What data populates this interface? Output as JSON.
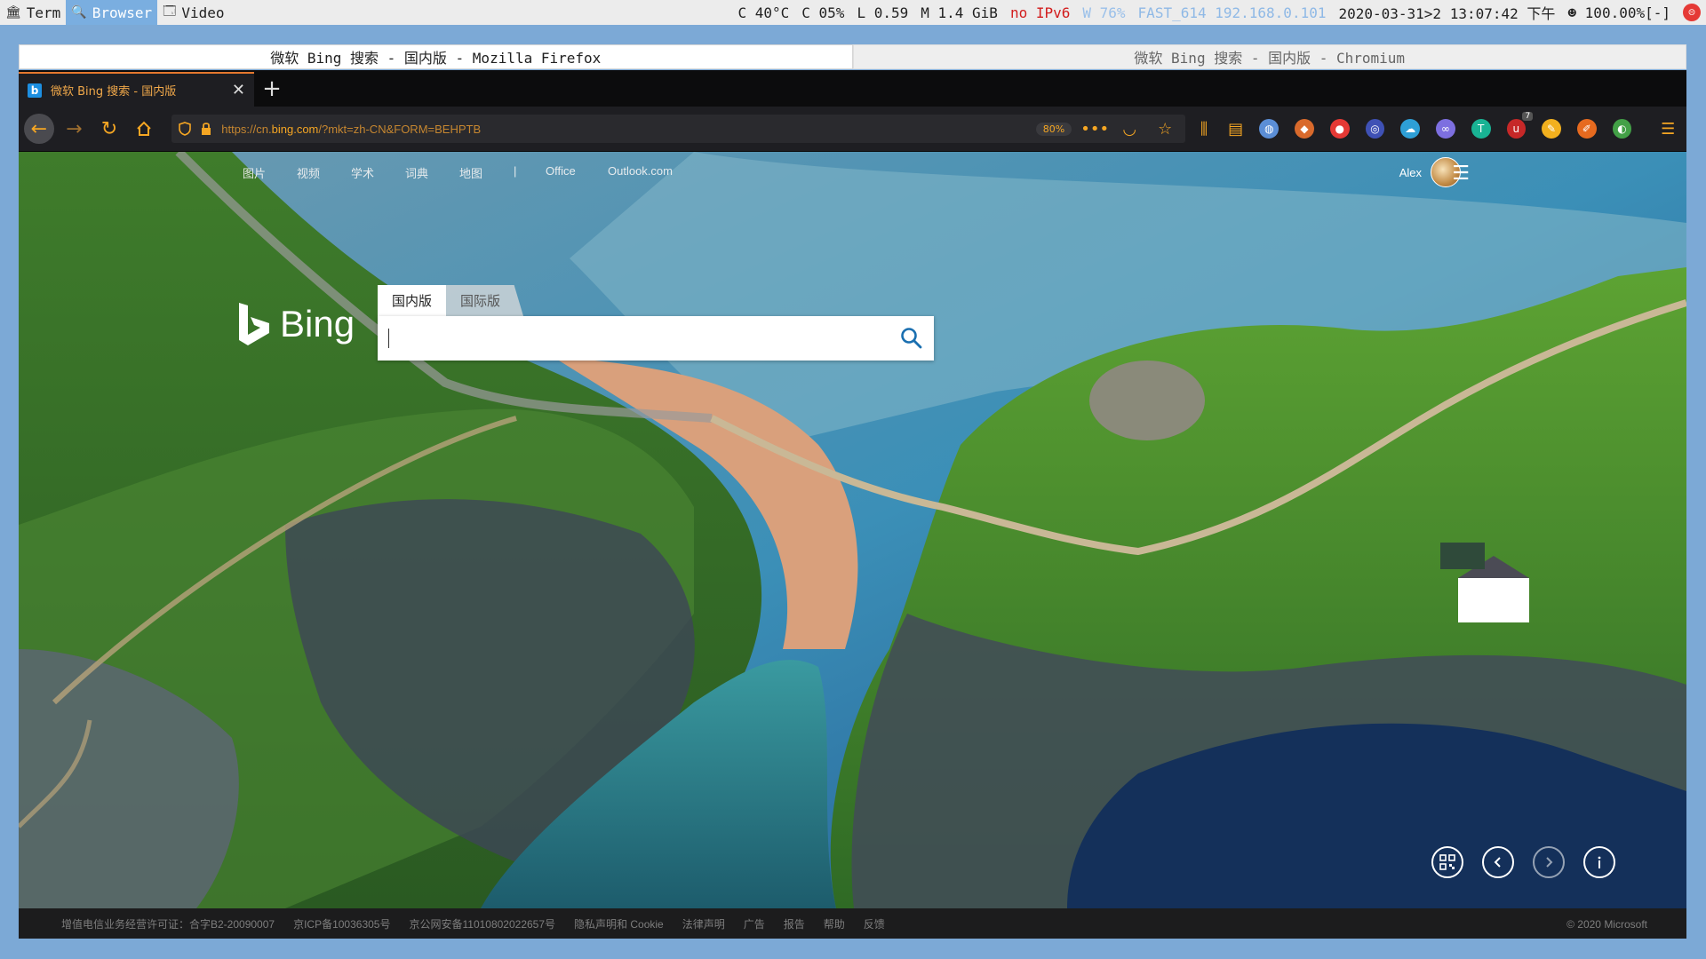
{
  "workspaces": [
    {
      "icon": "🏛",
      "label": "Term",
      "active": false
    },
    {
      "icon": "🔍",
      "label": "Browser",
      "active": true
    },
    {
      "icon": "🗔",
      "label": "Video",
      "active": false
    }
  ],
  "status": {
    "temp": "C 40°C",
    "cpu": "C 05%",
    "load": "L 0.59",
    "mem": "M 1.4 GiB",
    "ipv6": "no IPv6",
    "wifi": "W 76%",
    "net": "FAST_614 192.168.0.101",
    "datetime": "2020-03-31>2 13:07:42 下午",
    "volume": "☻ 100.00%[-]"
  },
  "wm_tabs": {
    "firefox": "微软 Bing 搜索 - 国内版 - Mozilla Firefox",
    "chromium": "微软 Bing 搜索 - 国内版 - Chromium"
  },
  "browser": {
    "tab_title": "微软 Bing 搜索 - 国内版",
    "url_prefix": "https://cn.",
    "url_domain": "bing.com",
    "url_rest": "/?mkt=zh-CN&FORM=BEHPTB",
    "zoom": "80%",
    "ext_badge": "7"
  },
  "bing": {
    "toplinks": [
      "图片",
      "视频",
      "学术",
      "词典",
      "地图",
      "|",
      "Office",
      "Outlook.com"
    ],
    "user_name": "Alex",
    "logo_text": "Bing",
    "search_tabs": [
      "国内版",
      "国际版"
    ],
    "search_value": ""
  },
  "footer": {
    "links": [
      "增值电信业务经营许可证：合字B2-20090007",
      "京ICP备10036305号",
      "京公网安备11010802022657号",
      "隐私声明和 Cookie",
      "法律声明",
      "广告",
      "报告",
      "帮助",
      "反馈"
    ],
    "copyright": "© 2020 Microsoft"
  },
  "colors": {
    "firefox_accent": "#f5a623",
    "active_workspace": "#7aaee0"
  }
}
